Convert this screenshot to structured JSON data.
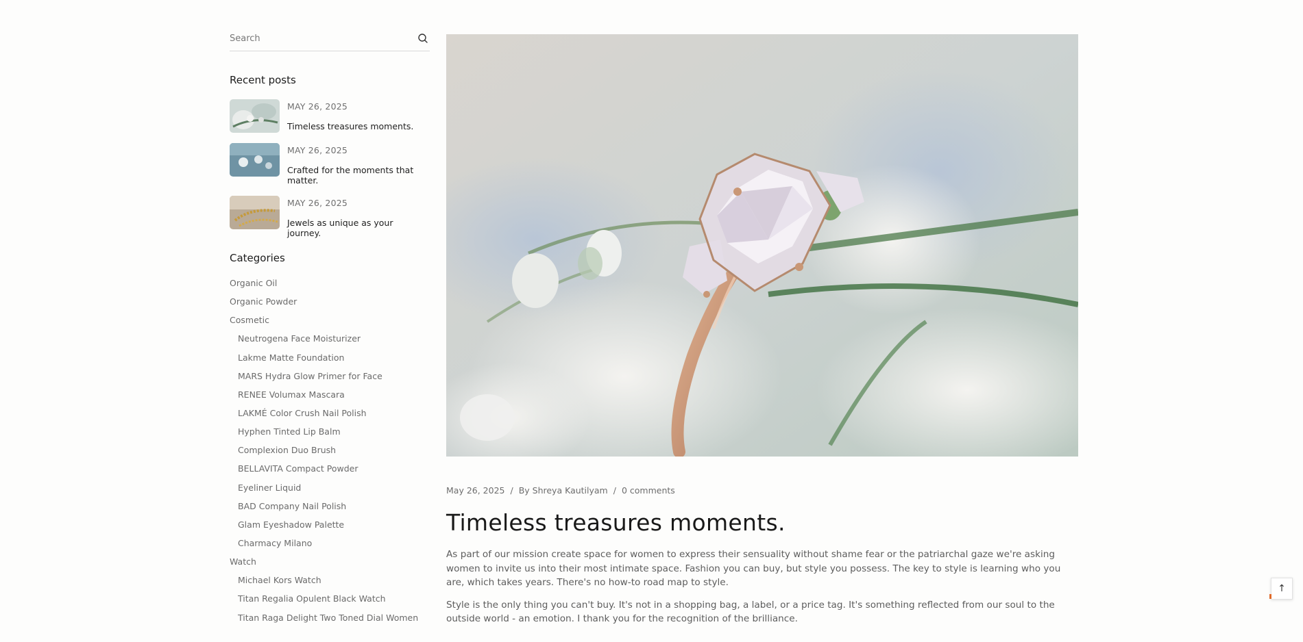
{
  "search": {
    "placeholder": "Search"
  },
  "recent_posts": {
    "title": "Recent posts",
    "items": [
      {
        "date": "MAY 26, 2025",
        "title": "Timeless treasures moments."
      },
      {
        "date": "MAY 26, 2025",
        "title": "Crafted for the moments that matter."
      },
      {
        "date": "MAY 26, 2025",
        "title": "Jewels as unique as your journey."
      }
    ]
  },
  "categories": {
    "title": "Categories",
    "items": [
      {
        "label": "Organic Oil",
        "level": 0
      },
      {
        "label": "Organic Powder",
        "level": 0
      },
      {
        "label": "Cosmetic",
        "level": 0
      },
      {
        "label": "Neutrogena Face Moisturizer",
        "level": 1
      },
      {
        "label": "Lakme Matte Foundation",
        "level": 1
      },
      {
        "label": "MARS Hydra Glow Primer for Face",
        "level": 1
      },
      {
        "label": "RENEE Volumax Mascara",
        "level": 1
      },
      {
        "label": "LAKMÉ Color Crush Nail Polish",
        "level": 1
      },
      {
        "label": "Hyphen Tinted Lip Balm",
        "level": 1
      },
      {
        "label": "Complexion Duo Brush",
        "level": 1
      },
      {
        "label": "BELLAVITA Compact Powder",
        "level": 1
      },
      {
        "label": "Eyeliner Liquid",
        "level": 1
      },
      {
        "label": "BAD Company Nail Polish",
        "level": 1
      },
      {
        "label": "Glam Eyeshadow Palette",
        "level": 1
      },
      {
        "label": "Charmacy Milano",
        "level": 1
      },
      {
        "label": "Watch",
        "level": 0
      },
      {
        "label": "Michael Kors Watch",
        "level": 1
      },
      {
        "label": "Titan Regalia Opulent Black Watch",
        "level": 1
      },
      {
        "label": "Titan Raga Delight Two Toned Dial Women",
        "level": 1
      }
    ]
  },
  "article": {
    "date": "May 26, 2025",
    "separator": "/",
    "author": "By Shreya Kautilyam",
    "comments": "0 comments",
    "title": "Timeless treasures moments.",
    "paragraphs": [
      "As part of our mission create space for women to express their sensuality without shame fear or the patriarchal gaze we're asking women to invite us into their most intimate space. Fashion you can buy, but style you possess. The key to style is learning who you are, which takes years. There's no how-to road map to style.",
      "Style is the only thing you can't buy. It's not in a shopping bag, a label, or a price tag. It's something reflected from our soul to the outside world - an emotion. I thank you for the recognition of the brilliance."
    ]
  },
  "scroll_top": {
    "icon": "arrow-up-icon",
    "glyph": "↑"
  }
}
